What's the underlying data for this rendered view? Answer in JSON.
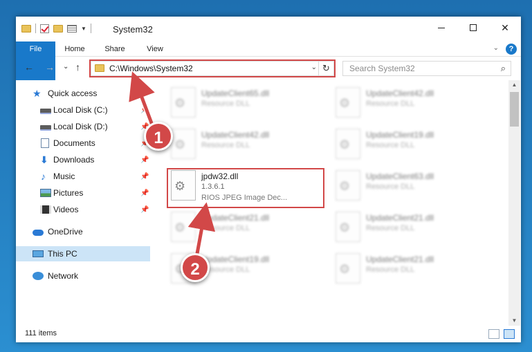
{
  "window": {
    "title": "System32",
    "caption": {
      "minimize": "",
      "maximize": "",
      "close": "✕"
    }
  },
  "ribbon": {
    "tabs": [
      "File",
      "Home",
      "Share",
      "View"
    ],
    "expand_glyph": "⌄",
    "help_glyph": "?"
  },
  "nav": {
    "back_glyph": "←",
    "forward_glyph": "→",
    "recent_glyph": "⌄",
    "up_glyph": "↑",
    "address_path": "C:\\Windows\\System32",
    "address_chevron": "⌄",
    "refresh_glyph": "↻",
    "search_placeholder": "Search System32",
    "search_glyph": "⌕"
  },
  "sidebar": {
    "items": [
      {
        "label": "Quick access",
        "icon": "star-icon",
        "pinned": false
      },
      {
        "label": "Local Disk (C:)",
        "icon": "drive-icon",
        "pinned": true
      },
      {
        "label": "Local Disk (D:)",
        "icon": "drive-icon",
        "pinned": true
      },
      {
        "label": "Documents",
        "icon": "documents-icon",
        "pinned": true
      },
      {
        "label": "Downloads",
        "icon": "downloads-icon",
        "pinned": true
      },
      {
        "label": "Music",
        "icon": "music-icon",
        "pinned": true
      },
      {
        "label": "Pictures",
        "icon": "pictures-icon",
        "pinned": true
      },
      {
        "label": "Videos",
        "icon": "videos-icon",
        "pinned": true
      },
      {
        "label": "OneDrive",
        "icon": "onedrive-icon",
        "pinned": false
      },
      {
        "label": "This PC",
        "icon": "this-pc-icon",
        "pinned": false,
        "selected": true
      },
      {
        "label": "Network",
        "icon": "network-icon",
        "pinned": false
      }
    ],
    "pin_glyph": "📌",
    "star_glyph": "★",
    "music_glyph": "♪",
    "download_glyph": "⬇"
  },
  "files": [
    {
      "name": "UpdateClient65.dll",
      "desc": "Resource DLL",
      "blurred": true
    },
    {
      "name": "UpdateClient42.dll",
      "desc": "Resource DLL",
      "blurred": true
    },
    {
      "name": "UpdateClient42.dll",
      "desc": "Resource DLL",
      "blurred": true
    },
    {
      "name": "UpdateClient19.dll",
      "desc": "Resource DLL",
      "blurred": true
    },
    {
      "name": "jpdw32.dll",
      "desc": "1.3.6.1",
      "desc2": "RIOS JPEG Image Dec...",
      "blurred": false
    },
    {
      "name": "UpdateClient63.dll",
      "desc": "Resource DLL",
      "blurred": true
    },
    {
      "name": "UpdateClient21.dll",
      "desc": "Resource DLL",
      "blurred": true
    },
    {
      "name": "UpdateClient21.dll",
      "desc": "Resource DLL",
      "blurred": true
    },
    {
      "name": "UpdateClient19.dll",
      "desc": "Resource DLL",
      "blurred": true
    },
    {
      "name": "UpdateClient21.dll",
      "desc": "Resource DLL",
      "blurred": true
    }
  ],
  "scrollbar": {
    "up_glyph": "▲",
    "down_glyph": "▼"
  },
  "status": {
    "item_count": "111 items"
  },
  "annotations": {
    "step1": "1",
    "step2": "2",
    "color": "#d24848"
  }
}
